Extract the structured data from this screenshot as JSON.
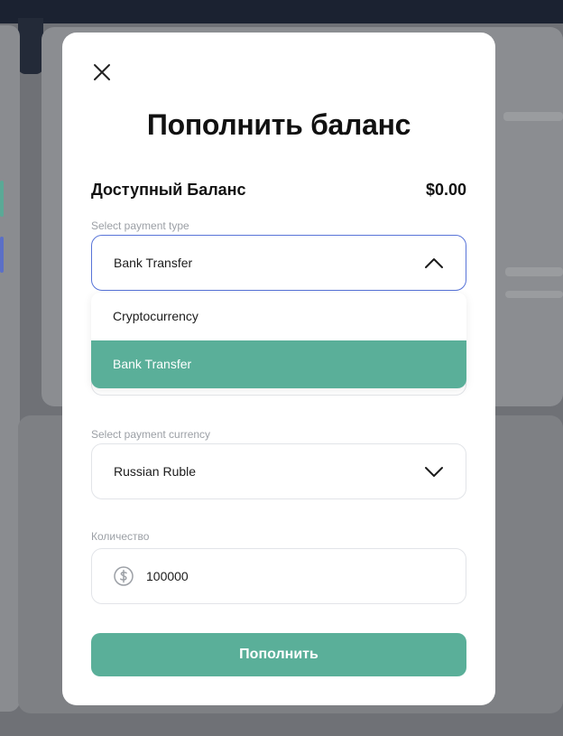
{
  "modal": {
    "title": "Пополнить баланс",
    "balance_label": "Доступный Баланс",
    "balance_value": "$0.00",
    "payment_type": {
      "label": "Select payment type",
      "value": "Bank Transfer",
      "options": [
        "Cryptocurrency",
        "Bank Transfer"
      ]
    },
    "payment_currency": {
      "label": "Select payment currency",
      "value": "Russian Ruble"
    },
    "amount": {
      "label": "Количество",
      "value": "100000"
    },
    "submit_label": "Пополнить"
  },
  "icons": {
    "close": "close-icon",
    "chevron_up": "chevron-up-icon",
    "chevron_down": "chevron-down-icon",
    "dollar": "dollar-circle-icon"
  },
  "colors": {
    "accent": "#5aaf99",
    "focus_border": "#5874d8",
    "overlay": "#6f7176"
  }
}
